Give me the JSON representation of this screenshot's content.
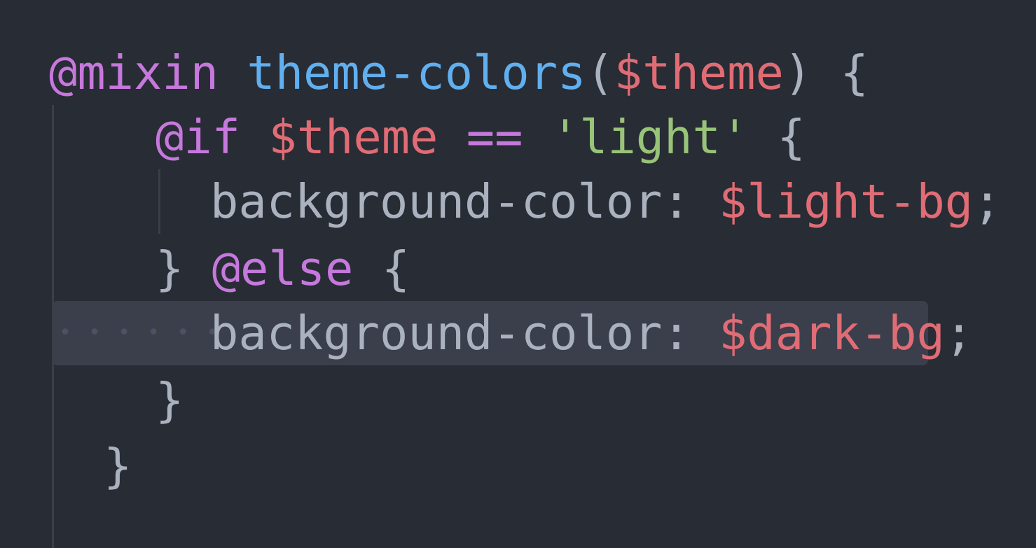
{
  "code": {
    "line1": {
      "keyword": "@mixin",
      "function_name": "theme-colors",
      "open_paren": "(",
      "param": "$theme",
      "close_paren_brace": ") {"
    },
    "line2": {
      "keyword": "@if",
      "variable": "$theme",
      "operator": "==",
      "string": "'light'",
      "brace": "{"
    },
    "line3": {
      "property": "background-color:",
      "value": "$light-bg",
      "semicolon": ";"
    },
    "line4": {
      "close_brace": "}",
      "keyword": "@else",
      "brace": "{"
    },
    "line5": {
      "property": "background-color:",
      "value": "$dark-bg",
      "semicolon": ";"
    },
    "line6": {
      "close_brace": "}"
    },
    "line7": {
      "close_brace": "}"
    }
  },
  "colors": {
    "background": "#282c34",
    "keyword": "#c678dd",
    "function": "#61afef",
    "variable": "#e06c75",
    "string": "#98c379",
    "plain": "#abb2bf",
    "line_highlight": "#3a3f4b",
    "indent_guide": "#3b4048"
  }
}
